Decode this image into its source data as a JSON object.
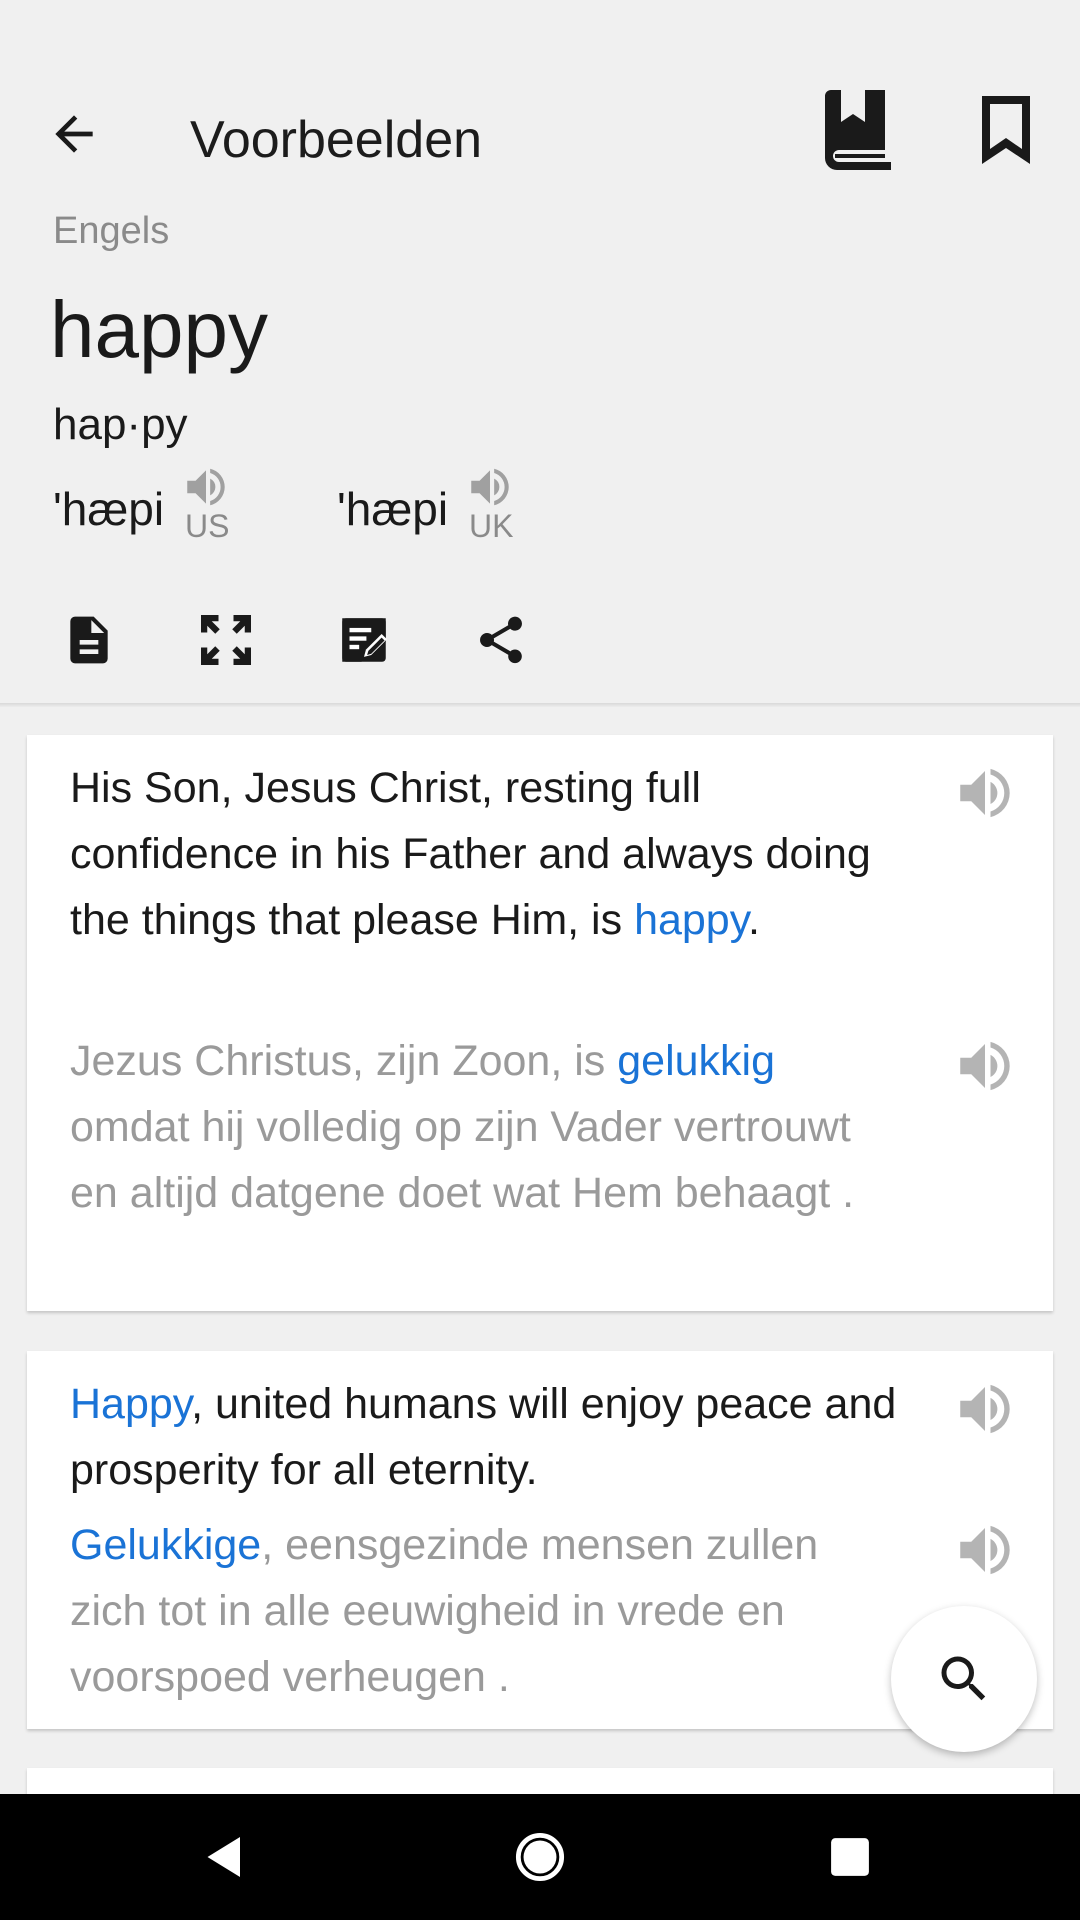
{
  "toolbar": {
    "title": "Voorbeelden",
    "back_icon": "arrow-left-icon",
    "dictionary_icon": "book-icon",
    "bookmark_icon": "bookmark-icon"
  },
  "entry": {
    "language": "Engels",
    "word": "happy",
    "syllables": "hap·py",
    "pronunciations": [
      {
        "ipa": "'hæpi",
        "region": "US",
        "icon": "speaker-icon"
      },
      {
        "ipa": "'hæpi",
        "region": "UK",
        "icon": "speaker-icon"
      }
    ]
  },
  "actions": [
    {
      "name": "document-icon"
    },
    {
      "name": "fullscreen-icon"
    },
    {
      "name": "edit-note-icon"
    },
    {
      "name": "share-icon"
    }
  ],
  "examples": [
    {
      "source": {
        "before": "His Son, Jesus Christ, resting full confidence in his Father and always doing the things that please Him, is ",
        "highlight": "happy",
        "after": "."
      },
      "translation": {
        "before": "Jezus Christus, zijn Zoon, is ",
        "highlight": "gelukkig",
        "after": " omdat hij volledig op zijn Vader vertrouwt en altijd datgene doet wat Hem behaagt ."
      }
    },
    {
      "source": {
        "before": "",
        "highlight": "Happy",
        "after": ", united humans will enjoy peace and prosperity for all eternity."
      },
      "translation": {
        "before": "",
        "highlight": "Gelukkige",
        "after": ", eensgezinde mensen zullen zich tot in alle eeuwigheid in vrede en voorspoed verheugen ."
      }
    }
  ],
  "fab": {
    "icon": "search-icon"
  },
  "colors": {
    "background": "#f0f0f0",
    "card": "#ffffff",
    "highlight": "#1a73d6",
    "translation_text": "#9a9a9a",
    "primary_text": "#1a1a1a"
  },
  "navigation": {
    "back_icon": "nav-back-icon",
    "home_icon": "nav-home-icon",
    "recents_icon": "nav-recents-icon"
  }
}
